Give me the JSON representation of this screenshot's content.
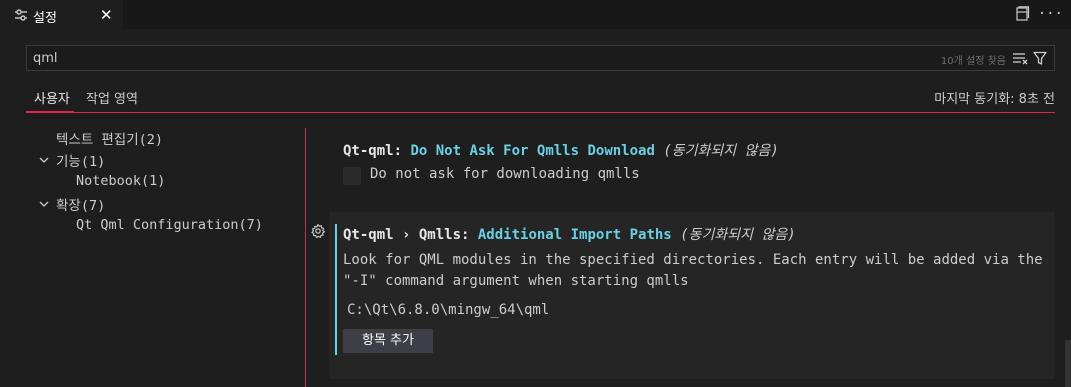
{
  "tab": {
    "label": "설정",
    "icon": "settings-sliders-icon",
    "close": "✕"
  },
  "top_actions": {
    "split_icon": "split-editor-icon",
    "more": "···"
  },
  "search": {
    "value": "qml",
    "count": "10개 설정 찾음"
  },
  "scope": {
    "user": "사용자",
    "workspace": "작업 영역",
    "sync_status": "마지막 동기화: 8초 전"
  },
  "toc": {
    "text_editor": "텍스트 편집기(2)",
    "features": "기능(1)",
    "notebook": "Notebook(1)",
    "extensions": "확장(7)",
    "qt_qml": "Qt Qml Configuration(7)"
  },
  "setting1": {
    "prefix": "Qt-qml:",
    "name": "Do Not Ask For Qmlls Download",
    "sync": "(동기화되지 않음)",
    "checkbox_label": "Do not ask for downloading qmlls"
  },
  "setting2": {
    "prefix": "Qt-qml › Qmlls:",
    "name": "Additional Import Paths",
    "sync": "(동기화되지 않음)",
    "description": "Look for QML modules in the specified directories. Each entry will be added via the \"-I\" command argument when starting qmlls",
    "path": "C:\\Qt\\6.8.0\\mingw_64\\qml",
    "add_button": "항목 추가"
  },
  "colors": {
    "accent": "#e5244a",
    "setting_name": "#6ad0e3",
    "background": "#1e1e1e"
  }
}
